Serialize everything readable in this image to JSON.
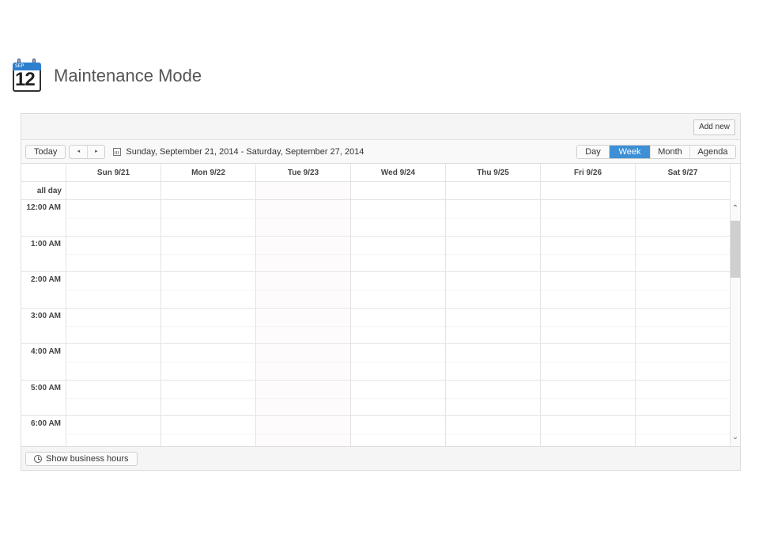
{
  "header": {
    "icon": {
      "month": "SEP",
      "day": "12"
    },
    "title": "Maintenance Mode"
  },
  "toolbar": {
    "add_label": "Add new",
    "today_label": "Today",
    "prev_glyph": "◂",
    "next_glyph": "▸",
    "date_range": "Sunday, September 21, 2014 - Saturday, September 27, 2014",
    "views": [
      "Day",
      "Week",
      "Month",
      "Agenda"
    ],
    "active_view": "Week"
  },
  "grid": {
    "days": [
      "Sun 9/21",
      "Mon 9/22",
      "Tue 9/23",
      "Wed 9/24",
      "Thu 9/25",
      "Fri 9/26",
      "Sat 9/27"
    ],
    "allday_label": "all day",
    "hours": [
      "12:00 AM",
      "1:00 AM",
      "2:00 AM",
      "3:00 AM",
      "4:00 AM",
      "5:00 AM",
      "6:00 AM"
    ]
  },
  "footer": {
    "business_hours_label": "Show business hours"
  },
  "colors": {
    "accent": "#3d8fd6"
  }
}
